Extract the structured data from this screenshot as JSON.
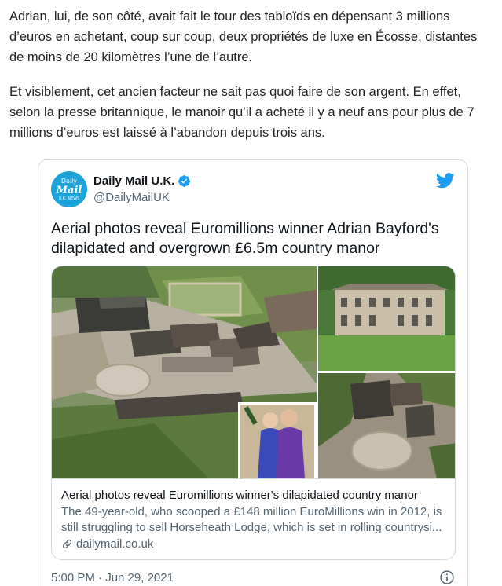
{
  "article": {
    "para1": "Adrian, lui, de son côté, avait fait le tour des tabloïds en dépensant 3 millions d’euros en achetant, coup sur coup, deux propriétés de luxe en Écosse, distantes de moins de 20 kilomètres l’une de l’autre.",
    "para2": "Et visiblement, cet ancien facteur ne sait pas quoi faire de son argent. En effet, selon la presse britannique, le manoir qu’il a acheté il y a neuf ans pour plus de 7 millions d’euros est laissé à l’abandon depuis trois ans."
  },
  "tweet": {
    "avatar": {
      "line1": "Daily",
      "line2": "Mail",
      "line3": "U.K. NEWS"
    },
    "author_name": "Daily Mail U.K.",
    "handle": "@DailyMailUK",
    "text": "Aerial photos reveal Euromillions winner Adrian Bayford's dilapidated and overgrown £6.5m country manor",
    "card": {
      "title": "Aerial photos reveal Euromillions winner's dilapidated country manor",
      "description": "The 49-year-old, who scooped a £148 million EuroMillions win in 2012, is still struggling to sell Horseheath Lodge, which is set in rolling countrysi...",
      "domain": "dailymail.co.uk"
    },
    "timestamp": "5:00 PM · Jun 29, 2021"
  },
  "colors": {
    "twitter_blue": "#1d9bf0",
    "verified_blue": "#1d9bf0",
    "avatar_bg": "#1ea3d8",
    "secondary_text": "#536471",
    "border": "#cfd9de"
  },
  "icons": [
    "verified-badge-icon",
    "twitter-bird-icon",
    "link-icon",
    "info-icon"
  ]
}
